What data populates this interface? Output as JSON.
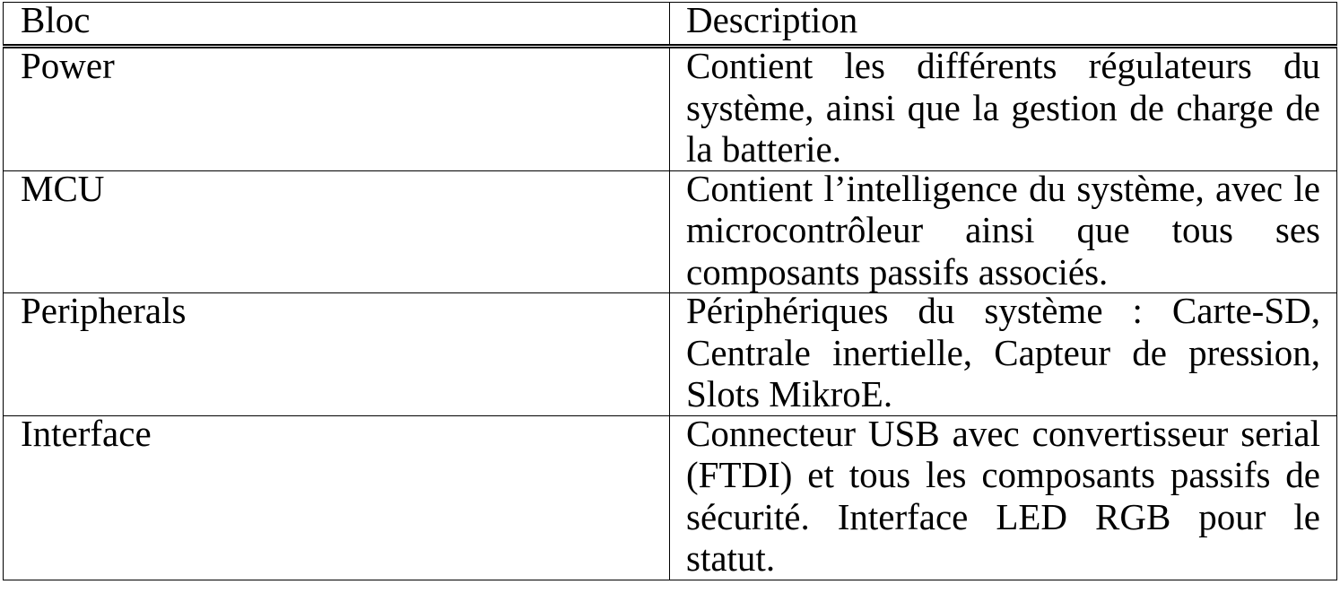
{
  "table": {
    "headers": {
      "bloc": "Bloc",
      "description": "Description"
    },
    "rows": [
      {
        "bloc": "Power",
        "description": "Contient les différents régulateurs du système, ainsi que la gestion de charge de la batterie."
      },
      {
        "bloc": "MCU",
        "description": "Contient l’intelligence du système, avec le microcontrôleur ainsi que tous ses composants passifs associés."
      },
      {
        "bloc": "Peripherals",
        "description": "Périphériques du système : Carte-SD, Centrale inertielle, Capteur de pres­sion, Slots MikroE."
      },
      {
        "bloc": "Interface",
        "description": "Connecteur USB avec convertisseur serial (FTDI) et tous les composants passifs de sécurité. Interface LED RGB pour le statut."
      }
    ]
  }
}
